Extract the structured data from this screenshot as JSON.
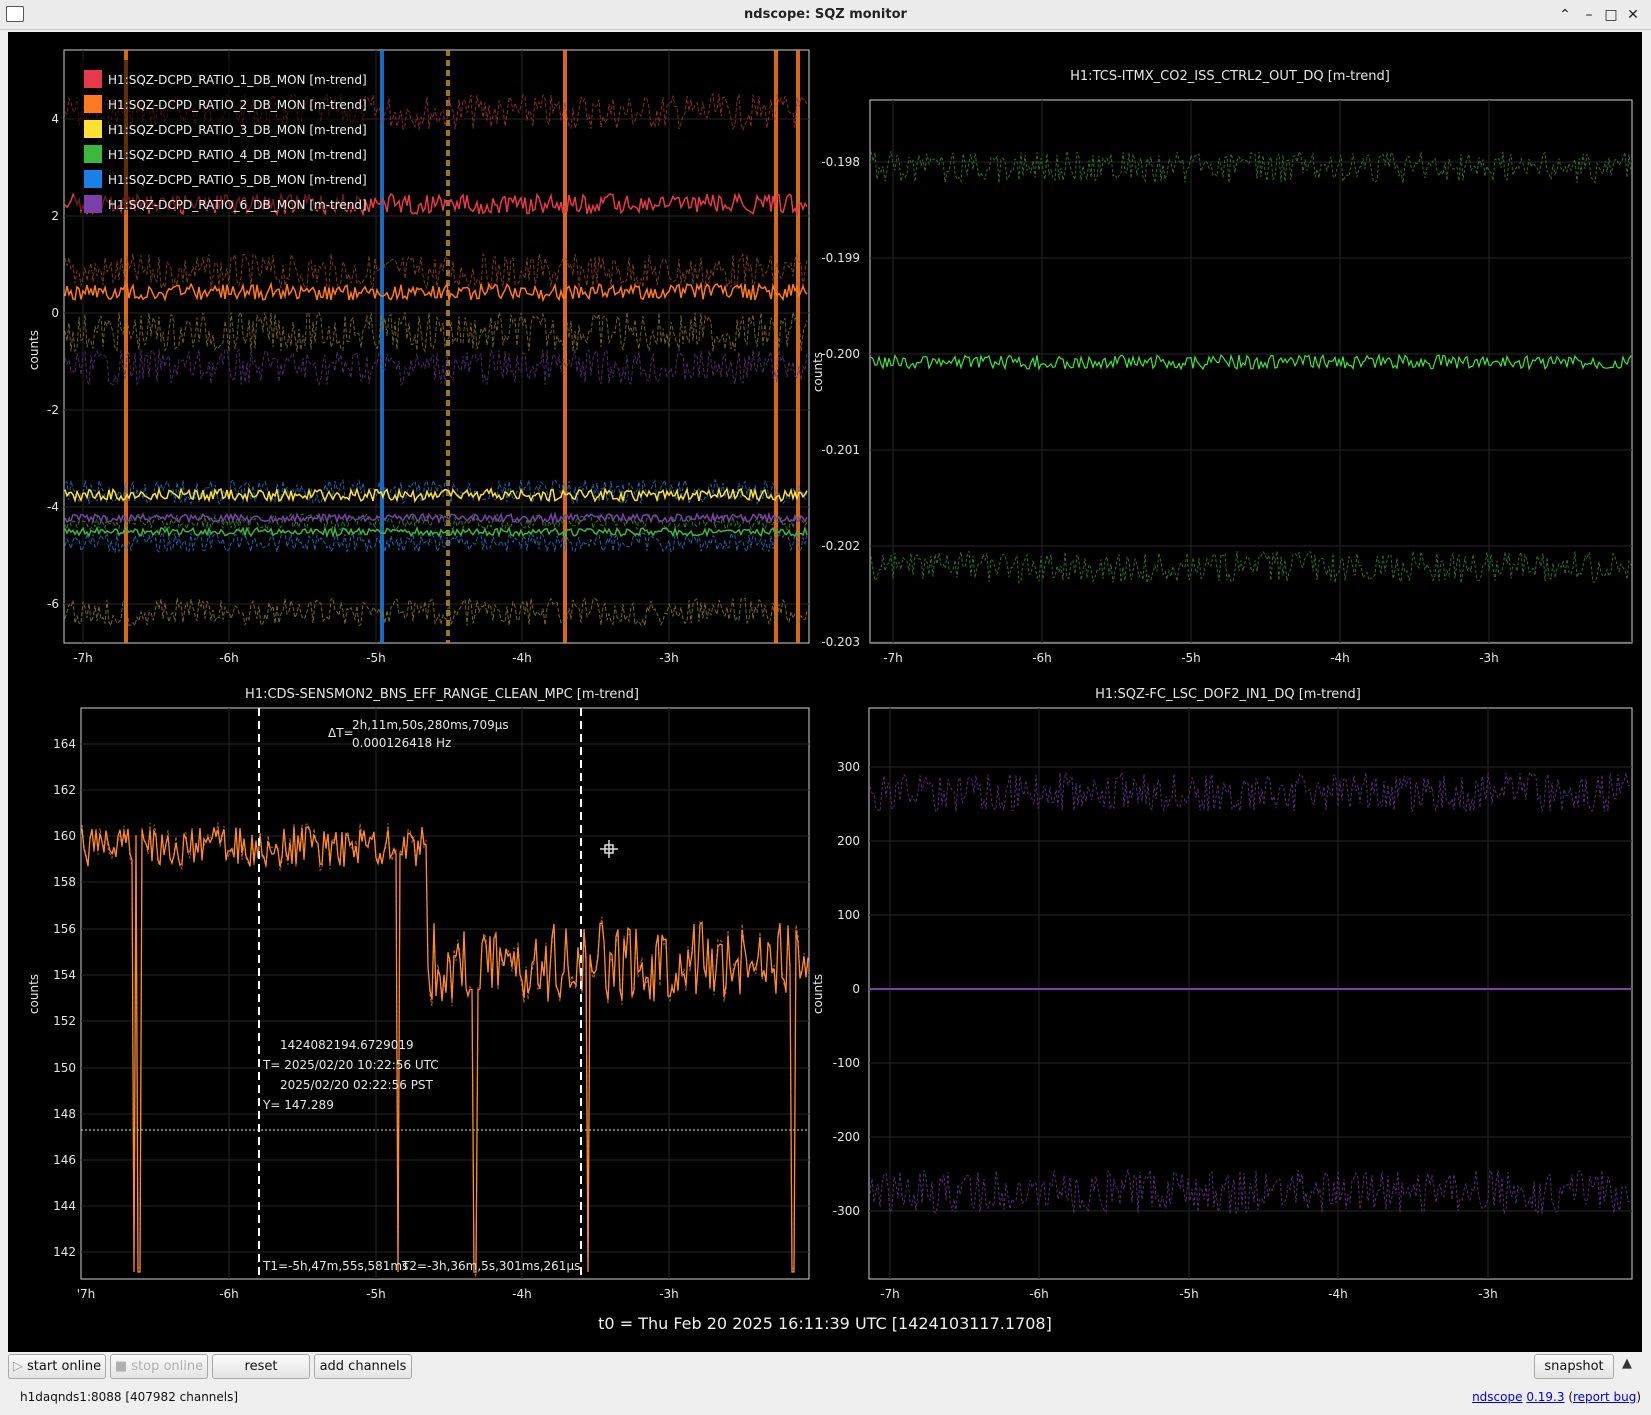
{
  "window": {
    "title": "ndscope: SQZ monitor"
  },
  "plots": {
    "top_left": {
      "title": "",
      "ylabel": "counts",
      "yticks": [
        "4",
        "2",
        "0",
        "-2",
        "-4",
        "-6"
      ],
      "xticks": [
        "-7h",
        "-6h",
        "-5h",
        "-4h",
        "-3h"
      ],
      "legend": [
        {
          "label": "H1:SQZ-DCPD_RATIO_1_DB_MON [m-trend]",
          "color": "#e8394a"
        },
        {
          "label": "H1:SQZ-DCPD_RATIO_2_DB_MON [m-trend]",
          "color": "#ff7a1c"
        },
        {
          "label": "H1:SQZ-DCPD_RATIO_3_DB_MON [m-trend]",
          "color": "#ffe030"
        },
        {
          "label": "H1:SQZ-DCPD_RATIO_4_DB_MON [m-trend]",
          "color": "#3cb83c"
        },
        {
          "label": "H1:SQZ-DCPD_RATIO_5_DB_MON [m-trend]",
          "color": "#1a7fe6"
        },
        {
          "label": "H1:SQZ-DCPD_RATIO_6_DB_MON [m-trend]",
          "color": "#7a3fa8"
        }
      ]
    },
    "top_right": {
      "title": "H1:TCS-ITMX_CO2_ISS_CTRL2_OUT_DQ [m-trend]",
      "ylabel": "counts",
      "yticks": [
        "-0.198",
        "-0.199",
        "-0.200",
        "-0.201",
        "-0.202",
        "-0.203"
      ],
      "xticks": [
        "-7h",
        "-6h",
        "-5h",
        "-4h",
        "-3h"
      ]
    },
    "bottom_left": {
      "title": "H1:CDS-SENSMON2_BNS_EFF_RANGE_CLEAN_MPC [m-trend]",
      "ylabel": "counts",
      "yticks": [
        "164",
        "162",
        "160",
        "158",
        "156",
        "154",
        "152",
        "150",
        "148",
        "146",
        "144",
        "142"
      ],
      "xticks": [
        "'7h",
        "-6h",
        "-5h",
        "-4h",
        "-3h"
      ],
      "delta_t_label": "ΔT=",
      "delta_t": "2h,11m,50s,280ms,709µs",
      "delta_f": "0.000126418 Hz",
      "cursor_gps": "1424082194.6729019",
      "cursor_t_utc": "T= 2025/02/20 10:22:56 UTC",
      "cursor_t_pst": "2025/02/20 02:22:56 PST",
      "cursor_y": "Y= 147.289",
      "t1": "T1=-5h,47m,55s,581ms",
      "t2": "T2=-3h,36m,5s,301ms,261µs"
    },
    "bottom_right": {
      "title": "H1:SQZ-FC_LSC_DOF2_IN1_DQ [m-trend]",
      "ylabel": "counts",
      "yticks": [
        "300",
        "200",
        "100",
        "0",
        "-100",
        "-200",
        "-300"
      ],
      "xticks": [
        "-7h",
        "-6h",
        "-5h",
        "-4h",
        "-3h"
      ]
    }
  },
  "t0": "t0 = Thu Feb 20 2025 16:11:39 UTC [1424103117.1708]",
  "toolbar": {
    "start_online": "start online",
    "stop_online": "stop online",
    "reset": "reset",
    "add_channels": "add channels",
    "snapshot": "snapshot"
  },
  "status": {
    "server": "h1daqnds1:8088  [407982 channels]"
  },
  "footer": {
    "app": "ndscope",
    "version": "0.19.3",
    "report": "report bug"
  }
}
